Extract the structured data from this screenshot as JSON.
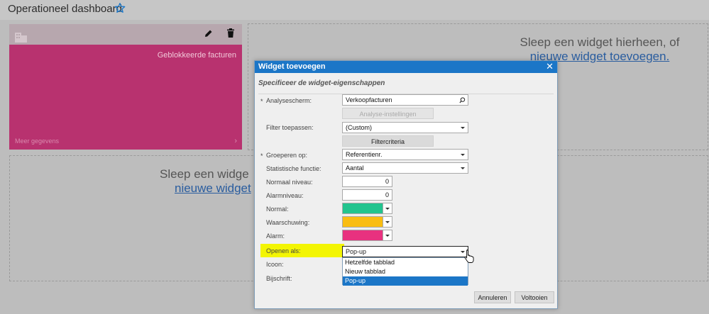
{
  "page": {
    "title": "Operationeel dashboard"
  },
  "drop_zones": {
    "top_right_text": "Sleep een widget hierheen, of",
    "top_right_link": "nieuwe widget toevoegen.",
    "bottom_left_text": "Sleep een widge",
    "bottom_left_link": "nieuwe widget"
  },
  "tile": {
    "title": "Geblokkeerde facturen",
    "more_label": "Meer gegevens",
    "color": "#b8326f"
  },
  "dialog": {
    "title": "Widget toevoegen",
    "subtitle": "Specificeer de widget-eigenschappen",
    "required_mark": "*",
    "fields": {
      "analysis_screen": {
        "label": "Analysescherm:",
        "value": "Verkoopfacturen"
      },
      "analysis_settings_button": "Analyse-instellingen",
      "filter": {
        "label": "Filter toepassen:",
        "value": "(Custom)"
      },
      "filter_criteria_button": "Filtercriteria",
      "group_by": {
        "label": "Groeperen op:",
        "value": "Referentienr."
      },
      "stat_function": {
        "label": "Statistische functie:",
        "value": "Aantal"
      },
      "normal_level": {
        "label": "Normaal niveau:",
        "value": "0"
      },
      "alarm_level": {
        "label": "Alarmniveau:",
        "value": "0"
      },
      "normal_color": {
        "label": "Normal:",
        "color": "#22c48e"
      },
      "warning_color": {
        "label": "Waarschuwing:",
        "color": "#f9bd12"
      },
      "alarm_color": {
        "label": "Alarm:",
        "color": "#e8317f"
      },
      "open_as": {
        "label": "Openen als:",
        "value": "Pop-up",
        "options": [
          "Hetzelfde tabblad",
          "Nieuw tabblad",
          "Pop-up"
        ]
      },
      "icon": {
        "label": "Icoon:"
      },
      "caption": {
        "label": "Bijschrift:"
      }
    },
    "cancel_label": "Annuleren",
    "finish_label": "Voltooien"
  },
  "colors": {
    "accent": "#1b76c7",
    "highlight": "#f3f503"
  }
}
